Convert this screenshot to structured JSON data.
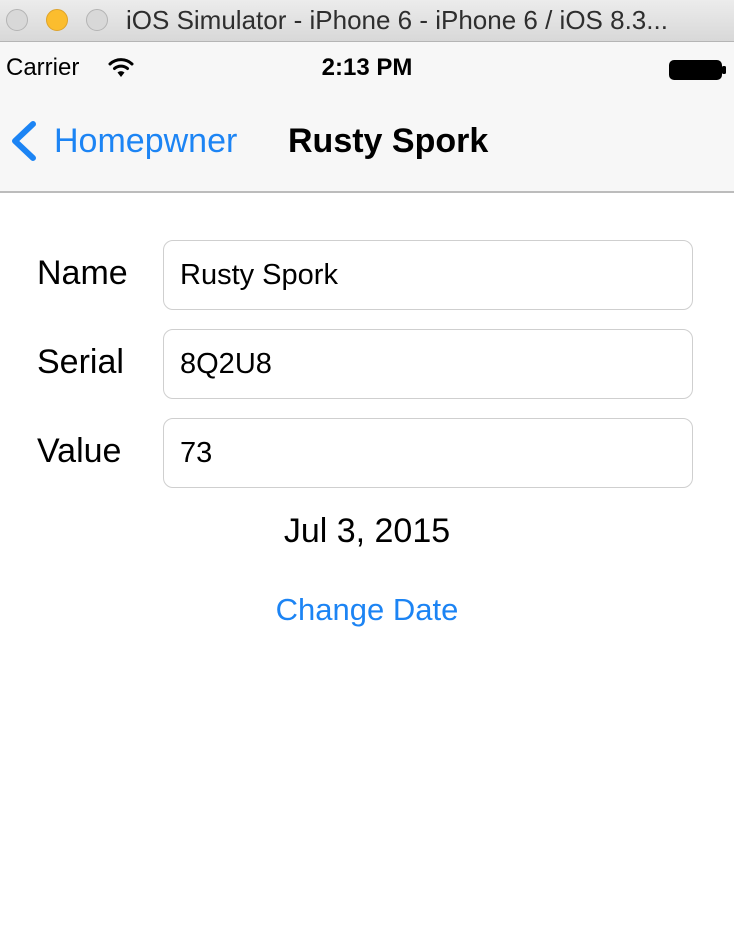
{
  "window": {
    "title": "iOS Simulator - iPhone 6 - iPhone 6 / iOS 8.3..."
  },
  "status_bar": {
    "carrier": "Carrier",
    "time": "2:13 PM",
    "wifi_icon": "wifi-icon",
    "battery_icon": "battery-icon"
  },
  "nav_bar": {
    "back_label": "Homepwner",
    "back_icon": "chevron-left-icon",
    "title": "Rusty Spork"
  },
  "form": {
    "name_label": "Name",
    "name_value": "Rusty Spork",
    "serial_label": "Serial",
    "serial_value": "8Q2U8",
    "value_label": "Value",
    "value_value": "73"
  },
  "date_label": "Jul 3, 2015",
  "change_date_label": "Change Date",
  "colors": {
    "tint": "#1c84f4",
    "bar_background": "#f7f7f7",
    "minimize_button": "#fbbd2e"
  }
}
